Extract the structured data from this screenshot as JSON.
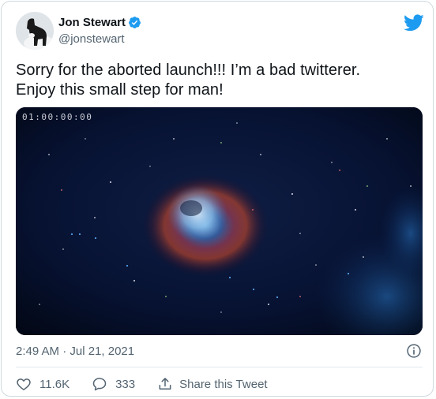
{
  "user": {
    "name": "Jon Stewart",
    "handle": "@jonstewart"
  },
  "tweet": {
    "text_lines": [
      "Sorry for the aborted launch!!! I’m a bad twitterer.",
      "Enjoy this small step for man!"
    ]
  },
  "media": {
    "timecode": "01:00:00:00"
  },
  "meta": {
    "timestamp": "2:49 AM · Jul 21, 2021"
  },
  "actions": {
    "likes": "11.6K",
    "replies": "333",
    "share_label": "Share this Tweet"
  },
  "colors": {
    "twitter_blue": "#1d9bf0",
    "text_secondary": "#536471",
    "text_primary": "#0f1419"
  },
  "icons": [
    "verified-badge-icon",
    "twitter-bird-icon",
    "info-icon",
    "heart-icon",
    "reply-icon",
    "share-icon"
  ]
}
